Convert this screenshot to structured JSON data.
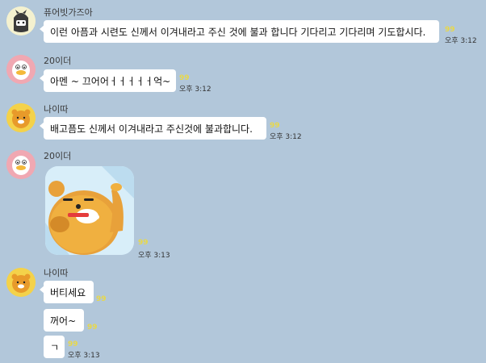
{
  "messages": [
    {
      "sender": "퓨어빗가즈아",
      "text": "이런 아픔과 시련도 신께서 이겨내라고 주신 것에 불과 합니다 기다리고 기다리며 기도합시다.",
      "unread": "99",
      "time": "오후 3:12"
    },
    {
      "sender": "20이더",
      "text": "아멘 ~ 끄어어ㅓㅓㅓㅓㅓ억~",
      "unread": "99",
      "time": "오후 3:12"
    },
    {
      "sender": "나이따",
      "text": "배고픔도 신께서 이겨내라고 주신것에 불과합니다.",
      "unread": "99",
      "time": "오후 3:12"
    },
    {
      "sender": "20이더",
      "sticker": "ryan-sticker",
      "unread": "99",
      "time": "오후 3:13"
    },
    {
      "sender": "나이따",
      "lines": [
        {
          "text": "버티세요",
          "unread": "99"
        },
        {
          "text": "꺼어~",
          "unread": "99"
        },
        {
          "text": "ㄱ",
          "unread": "99",
          "time": "오후 3:13"
        }
      ]
    }
  ],
  "colors": {
    "background": "#b2c7da",
    "bubble": "#ffffff",
    "unread": "#e8d84a"
  }
}
